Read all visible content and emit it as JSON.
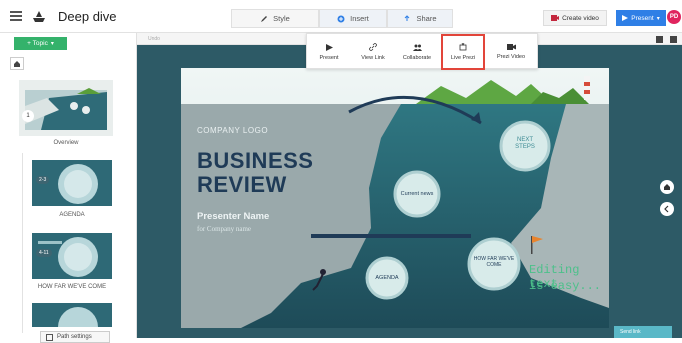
{
  "header": {
    "menu_icon": "hamburger-icon",
    "logo_icon": "ship-icon",
    "title": "Deep dive",
    "tabs": [
      {
        "label": "Style",
        "icon": "pencil-icon"
      },
      {
        "label": "Insert",
        "icon": "plus-circle-icon"
      },
      {
        "label": "Share",
        "icon": "share-icon"
      }
    ],
    "create_video_label": "Create video",
    "present_label": "Present",
    "avatar_initials": "PD"
  },
  "sidebar": {
    "topic_button": "+ Topic",
    "overview": {
      "badge": "",
      "label": "Overview"
    },
    "items": [
      {
        "range": "2-3",
        "label": "AGENDA"
      },
      {
        "range": "4-11",
        "label": "HOW FAR WE'VE COME"
      }
    ],
    "path_settings_label": "Path settings"
  },
  "toolbar": {
    "undo_label": "Undo"
  },
  "share_menu": {
    "items": [
      {
        "label": "Present",
        "icon": "play-icon"
      },
      {
        "label": "View Link",
        "icon": "link-icon"
      },
      {
        "label": "Collaborate",
        "icon": "people-icon"
      },
      {
        "label": "Live Prezi",
        "icon": "broadcast-icon",
        "highlighted": true
      },
      {
        "label": "Prezi Video",
        "icon": "video-camera-icon"
      }
    ]
  },
  "slide": {
    "company_logo": "COMPANY LOGO",
    "title_line1": "BUSINESS",
    "title_line2": "REVIEW",
    "presenter": "Presenter Name",
    "company": "for Company name",
    "circles": {
      "next_steps": "NEXT STEPS",
      "current_news": "Current news",
      "how_far": "HOW FAR WE'VE COME",
      "agenda": "AGENDA"
    },
    "note_line1": "Editing text",
    "note_line2": "is easy..."
  },
  "footer": {
    "corner_button": "Send link"
  },
  "colors": {
    "accent_blue": "#2f7fe6",
    "topic_green": "#34b26b",
    "highlight_red": "#e2453a",
    "slide_navy": "#1f3b57",
    "note_green": "#3fae7a"
  }
}
